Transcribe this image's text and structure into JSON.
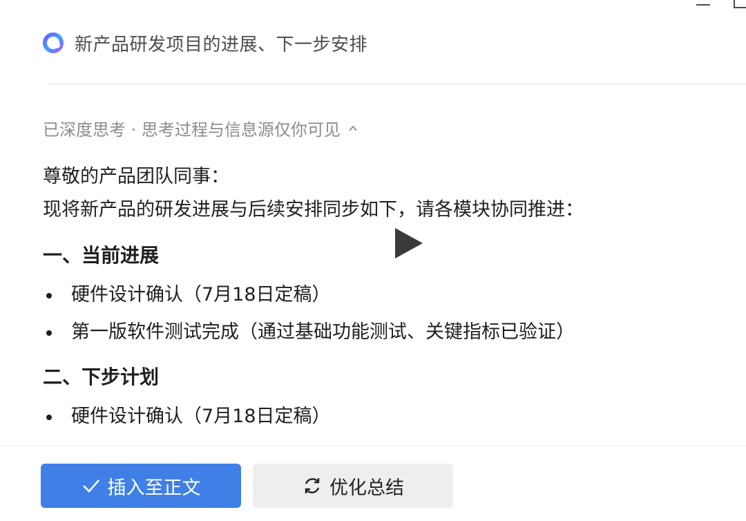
{
  "header": {
    "title": "新产品研发项目的进展、下一步安排",
    "logo_icon": "ring-logo-icon"
  },
  "thinking": {
    "label": "已深度思考 · 思考过程与信息源仅你可见",
    "toggle_icon": "chevron-up-icon"
  },
  "content": {
    "greeting": "尊敬的产品团队同事：",
    "intro": "现将新产品的研发进展与后续安排同步如下，请各模块协同推进：",
    "sections": [
      {
        "heading": "一、当前进展",
        "items": [
          "硬件设计确认（7月18日定稿）",
          "第一版软件测试完成（通过基础功能测试、关键指标已验证）"
        ]
      },
      {
        "heading": "二、下步计划",
        "items": [
          "硬件设计确认（7月18日定稿）"
        ]
      }
    ]
  },
  "overlay": {
    "icon": "play-icon"
  },
  "actions": {
    "insert_label": "插入至正文",
    "insert_icon": "check-icon",
    "optimize_label": "优化总结",
    "optimize_icon": "refresh-icon"
  },
  "colors": {
    "primary": "#3f7fe6",
    "secondary_bg": "#eeeeee",
    "muted_text": "#8c8c8c"
  }
}
